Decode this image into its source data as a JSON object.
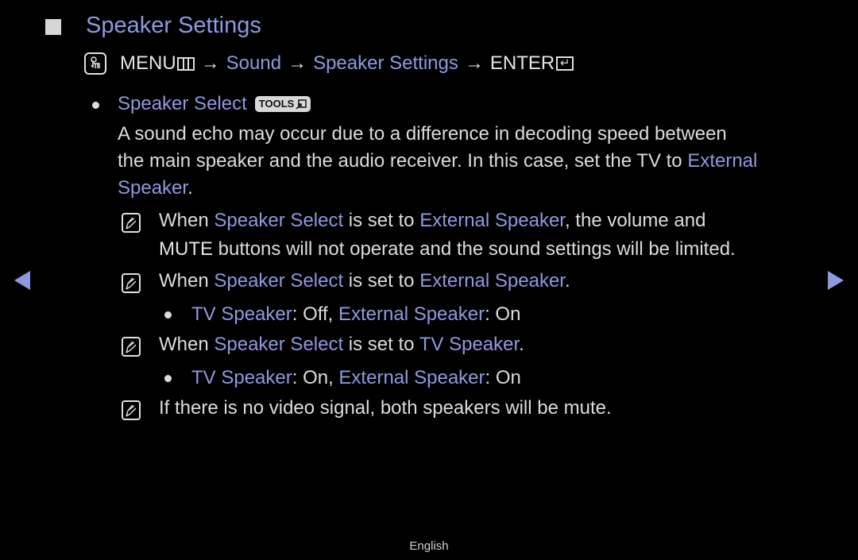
{
  "title": "Speaker Settings",
  "menu_path": {
    "menu_label": "MENU",
    "arrow": "→",
    "step1": "Sound",
    "step2": "Speaker Settings",
    "enter_label": "ENTER"
  },
  "section": {
    "title": "Speaker Select",
    "tools_badge": "TOOLS",
    "description": {
      "line1": "A sound echo may occur due to a difference in decoding speed between",
      "line2_prefix": "the main speaker and the audio receiver. In this case, set the TV to ",
      "line2_highlight": "External",
      "line3_highlight": "Speaker",
      "line3_suffix": "."
    }
  },
  "notes": [
    {
      "t1": "When ",
      "h1": "Speaker Select",
      "t2": " is set to ",
      "h2": "External Speaker",
      "t3": ", the volume and",
      "line2_bold": "MUTE",
      "line2_rest": " buttons will not operate and the sound settings will be limited."
    },
    {
      "t1": "When ",
      "h1": "Speaker Select",
      "t2": " is set to ",
      "h2": "External Speaker",
      "t3": ".",
      "sub": {
        "h1": "TV Speaker",
        "t1": ": Off, ",
        "h2": "External Speaker",
        "t2": ": On"
      }
    },
    {
      "t1": "When ",
      "h1": "Speaker Select",
      "t2": " is set to ",
      "h2": "TV Speaker",
      "t3": ".",
      "sub": {
        "h1": "TV Speaker",
        "t1": ": On, ",
        "h2": "External Speaker",
        "t2": ": On"
      }
    },
    {
      "t1": "If there is no video signal, both speakers will be mute."
    }
  ],
  "nav": {
    "prev_icon": "triangle-left",
    "next_icon": "triangle-right"
  },
  "footer": {
    "language": "English"
  },
  "colors": {
    "highlight": "#8e99e0",
    "text": "#dcdcdc",
    "background": "#000000"
  }
}
